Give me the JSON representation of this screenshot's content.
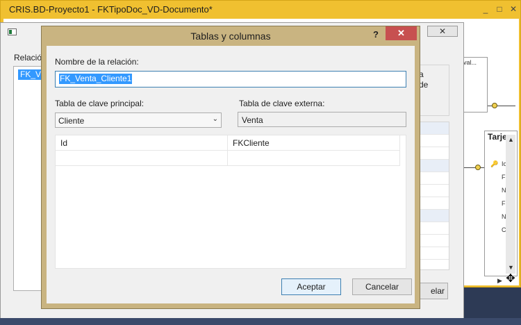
{
  "outer_window": {
    "title": "CRIS.BD-Proyecto1 - FKTipoDoc_VD-Documento*",
    "minimize_glyph": "_",
    "maximize_glyph": "□",
    "close_glyph": "✕"
  },
  "relationships_dialog": {
    "label": "Relació",
    "list_item": "FK_Ve",
    "right_text_line1": "a",
    "right_text_line2": "de",
    "cancel_label": "elar",
    "close_glyph": "✕"
  },
  "diagram": {
    "table1_header": "val...",
    "table2_title": "Tarje",
    "table2_rows": [
      "Io",
      "F",
      "N",
      "F",
      "N",
      "C"
    ]
  },
  "dialog": {
    "title": "Tablas y columnas",
    "help_glyph": "?",
    "close_glyph": "✕",
    "relation_name_label": "Nombre de la relación:",
    "relation_name_value": "FK_Venta_Cliente1",
    "pk_table_label": "Tabla de clave principal:",
    "pk_table_value": "Cliente",
    "fk_table_label": "Tabla de clave externa:",
    "fk_table_value": "Venta",
    "columns": [
      {
        "pk": "Id",
        "fk": "FKCliente"
      },
      {
        "pk": "",
        "fk": ""
      }
    ],
    "ok_label": "Aceptar",
    "cancel_label": "Cancelar"
  },
  "icons": {
    "dropdown": "chevron-down-icon",
    "move_cursor": "move-cursor-icon",
    "key": "primary-key-icon"
  },
  "colors": {
    "outer_title_bg": "#f0c030",
    "dialog_frame": "#c9b481",
    "close_red": "#c75050",
    "selection_blue": "#3399ff"
  }
}
